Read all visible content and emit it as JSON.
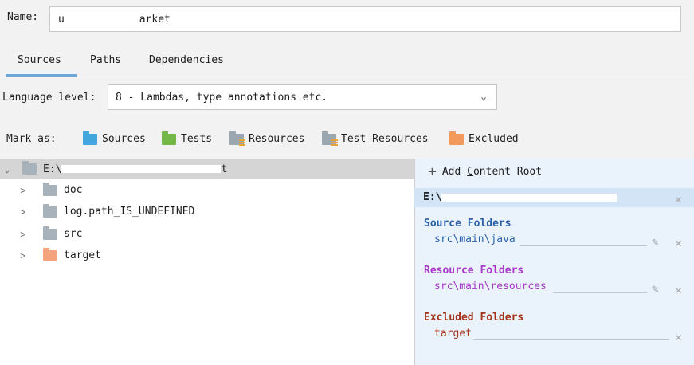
{
  "name": {
    "label": "Name:",
    "value": "u            arket"
  },
  "tabs": [
    "Sources",
    "Paths",
    "Dependencies"
  ],
  "active_tab": "Sources",
  "language_level": {
    "label": "Language level:",
    "value": "8 - Lambdas, type annotations etc."
  },
  "mark_as": {
    "label": "Mark as:",
    "items": [
      {
        "label_first": "S",
        "label_rest": "ources",
        "icon": "sources-folder-icon",
        "color": "#41a7dd"
      },
      {
        "label_first": "T",
        "label_rest": "ests",
        "icon": "tests-folder-icon",
        "color": "#74b84a"
      },
      {
        "label_first": "",
        "label_rest": "Resources",
        "icon": "resources-folder-icon",
        "color": "#9aa7b0"
      },
      {
        "label_first": "",
        "label_rest": "Test Resources",
        "icon": "test-resources-folder-icon",
        "color": "#9aa7b0"
      },
      {
        "label_first": "E",
        "label_rest": "xcluded",
        "icon": "excluded-folder-icon",
        "color": "#f29a5c"
      }
    ]
  },
  "tree": {
    "root": "E:\\",
    "root_tail": "t",
    "children": [
      {
        "label": "doc",
        "icon": "folder-icon"
      },
      {
        "label": "log.path_IS_UNDEFINED",
        "icon": "folder-icon"
      },
      {
        "label": "src",
        "icon": "folder-icon"
      },
      {
        "label": "target",
        "icon": "excluded-folder-icon"
      }
    ]
  },
  "right_panel": {
    "add_root_prefix": "Add ",
    "add_root_underline": "C",
    "add_root_rest": "ontent Root",
    "root_path": "E:\\",
    "sections": [
      {
        "title": "Source Folders",
        "path": "src\\main\\java",
        "editable": true
      },
      {
        "title": "Resource Folders",
        "path": "src\\main\\resources",
        "editable": true
      },
      {
        "title": "Excluded Folders",
        "path": "target",
        "editable": false
      }
    ]
  },
  "colors": {
    "sources": "#2b5fa8",
    "resources": "#a838c9",
    "excluded": "#a3321c",
    "panel_bg": "#eaf3fb"
  }
}
